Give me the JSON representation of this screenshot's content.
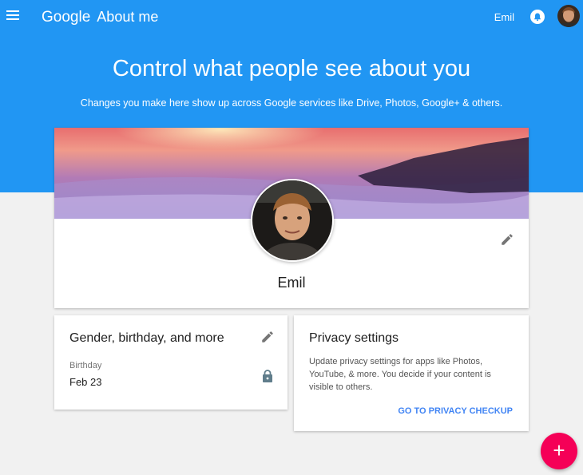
{
  "header": {
    "google_label": "Google",
    "app_title": "About me",
    "user_name": "Emil",
    "menu_icon": "hamburger-menu-icon",
    "notifications_icon": "bell-icon"
  },
  "hero": {
    "title": "Control what people see about you",
    "subtitle": "Changes you make here show up across Google services like Drive, Photos, Google+ & others."
  },
  "profile": {
    "name": "Emil",
    "edit_icon": "pencil-icon"
  },
  "basic_info": {
    "title": "Gender, birthday, and more",
    "birthday_label": "Birthday",
    "birthday_value": "Feb 23",
    "lock_icon": "lock-icon"
  },
  "privacy": {
    "title": "Privacy settings",
    "description": "Update privacy settings for apps like Photos, YouTube, & more. You decide if your content is visible to others.",
    "link": "GO TO PRIVACY CHECKUP"
  },
  "fab": {
    "label": "+"
  },
  "colors": {
    "primary": "#2196f3",
    "accent": "#f50057",
    "link": "#4285f4",
    "background": "#f1f1f1"
  }
}
